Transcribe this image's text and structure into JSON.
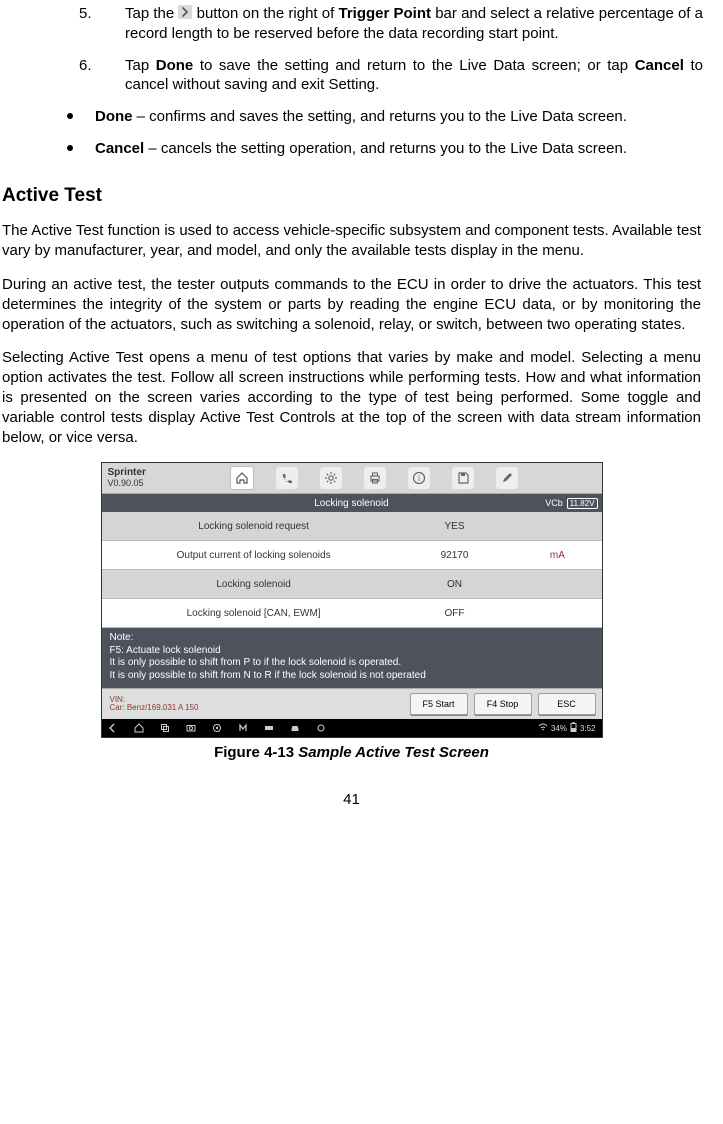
{
  "steps": {
    "s5": {
      "num": "5.",
      "pre": "Tap  the  ",
      "mid": "  button  on  the  right  of  ",
      "bold": "Trigger  Point",
      "post": "  bar  and  select  a relative percentage of a record length to be reserved before the data recording start point."
    },
    "s6": {
      "num": "6.",
      "pre": "Tap ",
      "b1": "Done",
      "mid": " to save the setting and return to the Live Data screen; or tap ",
      "b2": "Cancel",
      "post": " to cancel without saving and exit Setting."
    }
  },
  "bullets": {
    "done": {
      "label": "Done",
      "text": " – confirms and saves the setting, and returns you to the Live Data screen."
    },
    "cancel": {
      "label": "Cancel",
      "text": " – cancels the setting operation, and returns you to the Live Data screen."
    }
  },
  "heading": "Active Test",
  "para1": "The Active Test function is used to access vehicle-specific subsystem and component tests. Available test vary by manufacturer, year, and model, and only the available tests display in the menu.",
  "para2": "During an active test, the tester outputs commands to the ECU in order to drive the actuators.  This  test  determines  the  integrity  of  the  system  or  parts  by  reading  the engine ECU data, or by monitoring the operation of the actuators, such as switching a solenoid, relay, or switch, between two operating states.",
  "para3": "Selecting Active Test opens a menu of test options that varies by make and model. Selecting  a  menu  option  activates  the  test.  Follow  all  screen  instructions  while performing  tests.  How  and  what  information  is  presented  on  the  screen  varies according to the type of test being performed. Some toggle and variable control tests display Active Test Controls at the top of the screen with data stream information below, or vice versa.",
  "screenshot": {
    "top": {
      "appname": "Sprinter",
      "version": "V0.90.05"
    },
    "titlebar": {
      "title": "Locking solenoid",
      "vci": "VCb",
      "voltage": "11.82V"
    },
    "rows": [
      {
        "name": "Locking solenoid request",
        "value": "YES",
        "unit": ""
      },
      {
        "name": "Output current of locking solenoids",
        "value": "92170",
        "unit": "mA"
      },
      {
        "name": "Locking solenoid",
        "value": "ON",
        "unit": ""
      },
      {
        "name": "Locking solenoid [CAN, EWM]",
        "value": "OFF",
        "unit": ""
      }
    ],
    "note": {
      "l1": "Note:",
      "l2": "F5: Actuate lock solenoid",
      "l3": "It is only possible to shift from P to if the lock solenoid is operated.",
      "l4": "It is only possible to shift from N to R if the lock solenoid is not operated"
    },
    "vinbar": {
      "vin_label": "VIN:",
      "car": "Car: Benz/169.031 A 150"
    },
    "buttons": {
      "f5": "F5 Start",
      "f4": "F4 Stop",
      "esc": "ESC"
    },
    "sysbar": {
      "batt": "34%",
      "time": "3:52"
    }
  },
  "caption": {
    "label": "Figure 4-13 ",
    "title": "Sample Active Test Screen"
  },
  "page_number": "41"
}
